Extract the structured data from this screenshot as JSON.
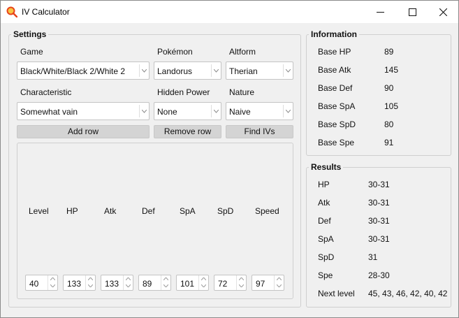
{
  "window": {
    "title": "IV Calculator",
    "controls": {
      "minimize": "─",
      "maximize": "☐",
      "close": "✕"
    }
  },
  "settings": {
    "legend": "Settings",
    "game_label": "Game",
    "game_value": "Black/White/Black 2/White 2",
    "pokemon_label": "Pokémon",
    "pokemon_value": "Landorus",
    "altform_label": "Altform",
    "altform_value": "Therian",
    "characteristic_label": "Characteristic",
    "characteristic_value": "Somewhat vain",
    "hidden_power_label": "Hidden Power",
    "hidden_power_value": "None",
    "nature_label": "Nature",
    "nature_value": "Naive",
    "add_row": "Add row",
    "remove_row": "Remove row",
    "find_ivs": "Find IVs",
    "stats_table": {
      "headers": [
        "Level",
        "HP",
        "Atk",
        "Def",
        "SpA",
        "SpD",
        "Speed"
      ],
      "row": [
        "40",
        "133",
        "133",
        "89",
        "101",
        "72",
        "97"
      ]
    }
  },
  "information": {
    "legend": "Information",
    "rows": [
      {
        "label": "Base HP",
        "value": "89"
      },
      {
        "label": "Base Atk",
        "value": "145"
      },
      {
        "label": "Base Def",
        "value": "90"
      },
      {
        "label": "Base SpA",
        "value": "105"
      },
      {
        "label": "Base SpD",
        "value": "80"
      },
      {
        "label": "Base Spe",
        "value": "91"
      }
    ]
  },
  "results": {
    "legend": "Results",
    "rows": [
      {
        "label": "HP",
        "value": "30-31"
      },
      {
        "label": "Atk",
        "value": "30-31"
      },
      {
        "label": "Def",
        "value": "30-31"
      },
      {
        "label": "SpA",
        "value": "30-31"
      },
      {
        "label": "SpD",
        "value": "31"
      },
      {
        "label": "Spe",
        "value": "28-30"
      },
      {
        "label": "Next level",
        "value": "45, 43, 46, 42, 40, 42"
      }
    ]
  },
  "icons": {
    "app": "magnifier-icon",
    "dropdown": "chevron-down-icon",
    "spin_up": "chevron-up-icon",
    "spin_down": "chevron-down-icon"
  },
  "colors": {
    "app_icon_ring": "#e8431a",
    "app_icon_fill": "#f7c544",
    "button_bg": "#d4d4d4",
    "window_bg": "#f0f0f0"
  }
}
